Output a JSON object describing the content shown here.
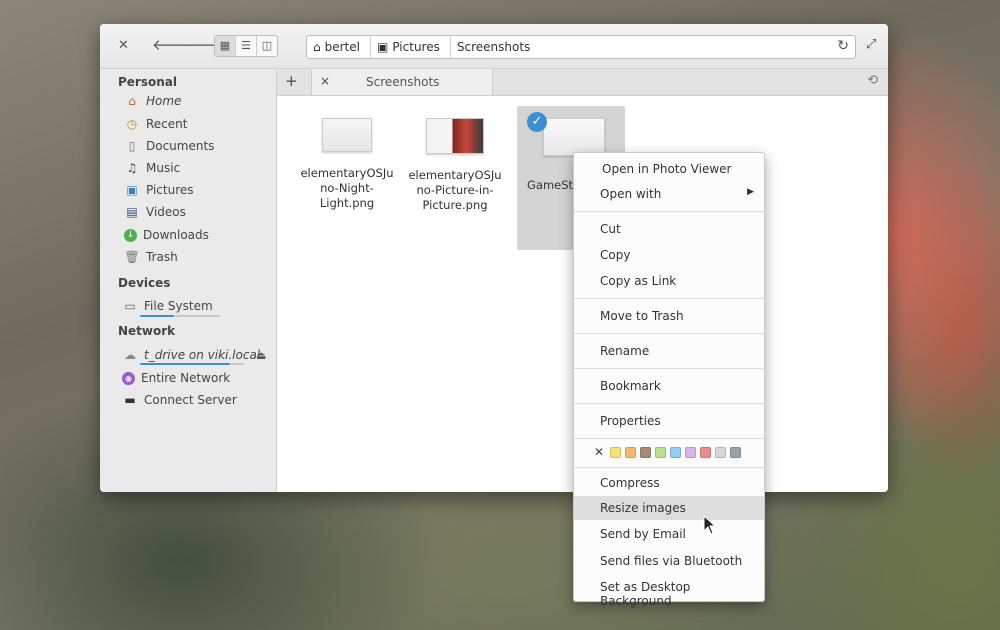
{
  "titlebar": {
    "breadcrumbs": [
      {
        "label": "bertel",
        "icon": "home-icon"
      },
      {
        "label": "Pictures",
        "icon": "pictures-folder-icon"
      },
      {
        "label": "Screenshots",
        "icon": ""
      }
    ]
  },
  "sidebar": {
    "personal_header": "Personal",
    "personal": [
      {
        "label": "Home",
        "icon": "home-icon"
      },
      {
        "label": "Recent",
        "icon": "recent-icon"
      },
      {
        "label": "Documents",
        "icon": "documents-icon"
      },
      {
        "label": "Music",
        "icon": "music-icon"
      },
      {
        "label": "Pictures",
        "icon": "pictures-icon"
      },
      {
        "label": "Videos",
        "icon": "videos-icon"
      },
      {
        "label": "Downloads",
        "icon": "downloads-icon"
      },
      {
        "label": "Trash",
        "icon": "trash-icon"
      }
    ],
    "devices_header": "Devices",
    "devices": [
      {
        "label": "File System",
        "icon": "drive-icon"
      }
    ],
    "network_header": "Network",
    "network": [
      {
        "label": "t_drive on viki.local",
        "icon": "cloud-icon"
      },
      {
        "label": "Entire Network",
        "icon": "network-icon"
      },
      {
        "label": "Connect Server",
        "icon": "server-icon"
      }
    ]
  },
  "tabs": {
    "add": "+",
    "close": "×",
    "active_label": "Screenshots"
  },
  "files": [
    {
      "name": "elementaryOSJu\nno-Night-\nLight.png"
    },
    {
      "name": "elementaryOSJu\nno-Picture-in-\nPicture.png"
    },
    {
      "name": "GameStor"
    }
  ],
  "context_menu": {
    "items": [
      {
        "label": "Open in Photo Viewer"
      },
      {
        "label": "Open with",
        "submenu": true
      },
      {
        "label": "Cut"
      },
      {
        "label": "Copy"
      },
      {
        "label": "Copy as Link"
      },
      {
        "label": "Move to Trash"
      },
      {
        "label": "Rename"
      },
      {
        "label": "Bookmark"
      },
      {
        "label": "Properties"
      },
      {
        "label": "Compress"
      },
      {
        "label": "Resize images",
        "highlighted": true
      },
      {
        "label": "Send by Email"
      },
      {
        "label": "Send files via Bluetooth"
      },
      {
        "label": "Set as Desktop Background"
      }
    ],
    "color_tags": [
      "#f5e17a",
      "#f2b86b",
      "#a38a70",
      "#b9e08a",
      "#8fcdf2",
      "#d9b3f0",
      "#f08c8c",
      "#d6d6d6",
      "#98a2ab"
    ]
  },
  "colors": {
    "accent": "#3a8fd6"
  }
}
